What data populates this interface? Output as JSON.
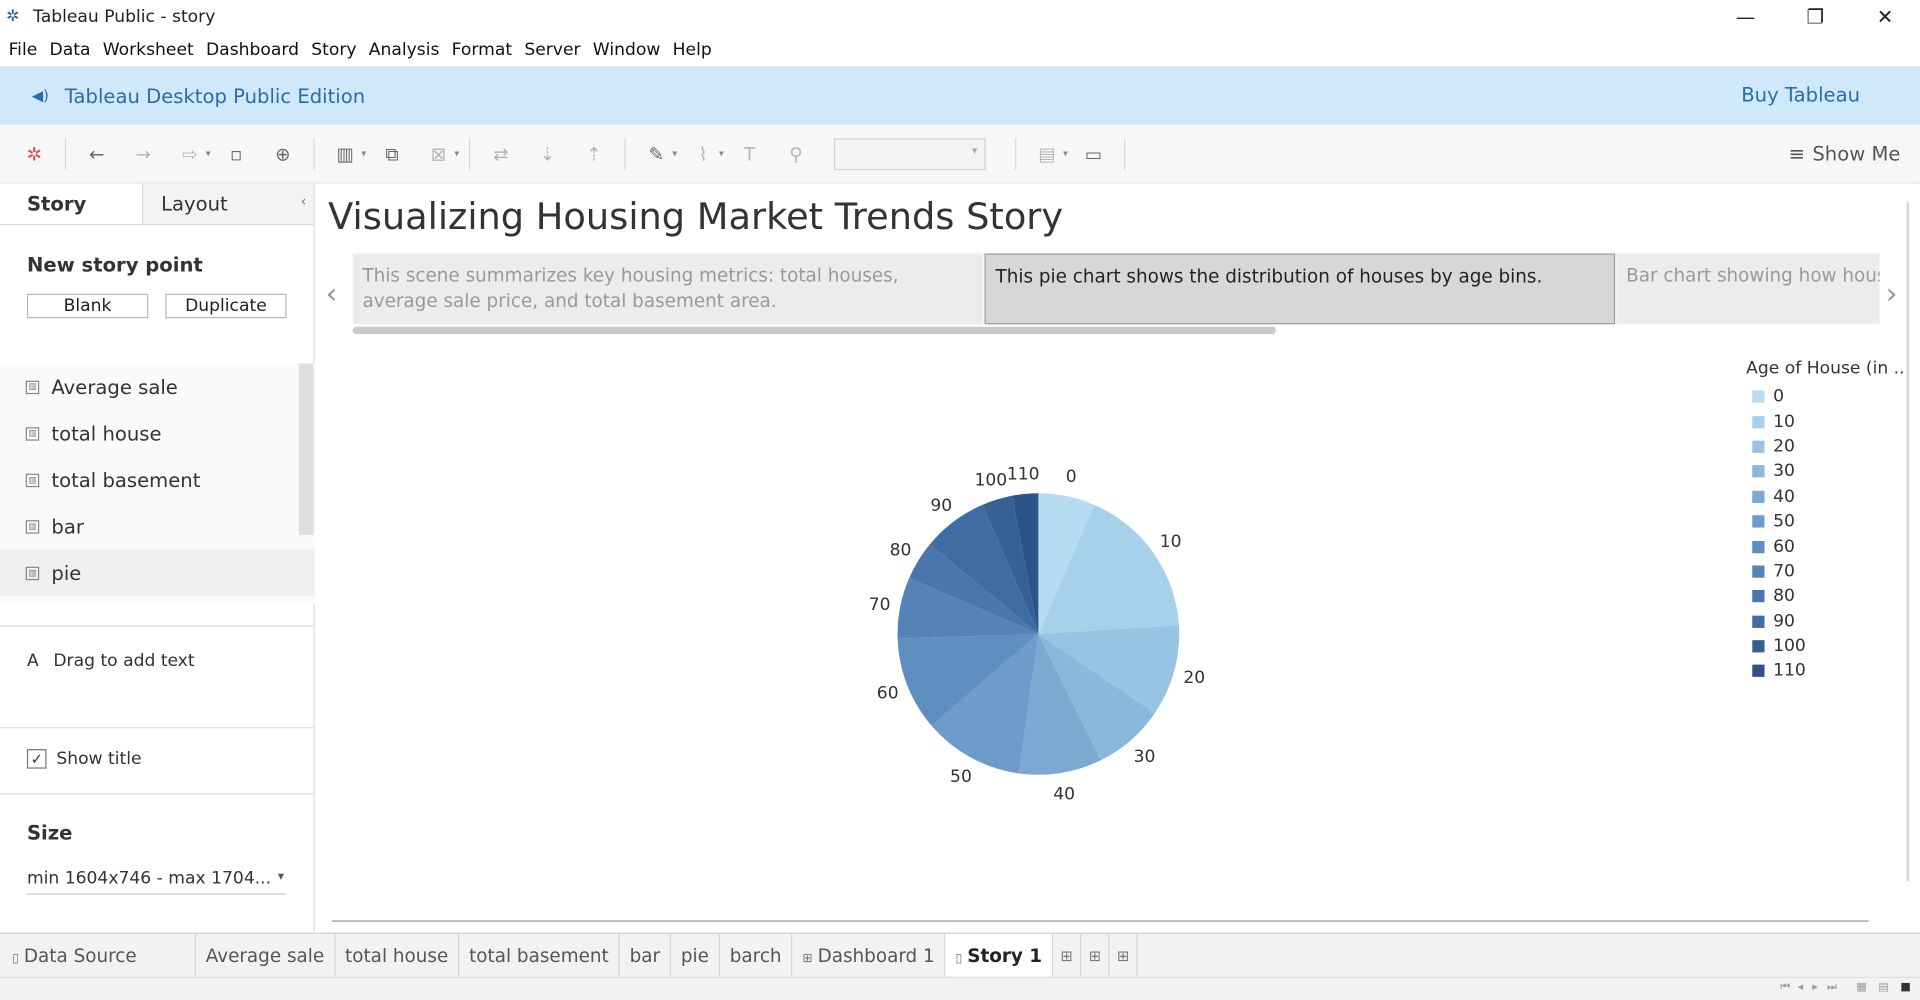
{
  "window": {
    "title": "Tableau Public - story",
    "controls": [
      "—",
      "❐",
      "✕"
    ]
  },
  "menu": [
    "File",
    "Data",
    "Worksheet",
    "Dashboard",
    "Story",
    "Analysis",
    "Format",
    "Server",
    "Window",
    "Help"
  ],
  "banner": {
    "edition": "Tableau Desktop Public Edition",
    "buy": "Buy Tableau"
  },
  "toolbar": {
    "show_me": "Show Me"
  },
  "left_panel": {
    "tabs": [
      "Story",
      "Layout"
    ],
    "new_story_point": "New story point",
    "blank": "Blank",
    "duplicate": "Duplicate",
    "sheets": [
      "Average sale",
      "total house",
      "total basement",
      "bar",
      "pie"
    ],
    "drag_text": "Drag to add text",
    "show_title": "Show title",
    "size_heading": "Size",
    "size_value": "min 1604x746 - max 1704..."
  },
  "story": {
    "title": "Visualizing Housing Market Trends Story",
    "points": [
      "This scene summarizes key housing metrics: total houses, average sale price, and total basement area.",
      "This pie chart shows the distribution of houses by age bins.",
      "Bar chart showing how house"
    ]
  },
  "chart_data": {
    "type": "pie",
    "legend_title": "Age of House (in ..",
    "categories": [
      "0",
      "10",
      "20",
      "30",
      "40",
      "50",
      "60",
      "70",
      "80",
      "90",
      "100",
      "110"
    ],
    "values": [
      6.5,
      17.5,
      10.5,
      8.2,
      9.5,
      11.5,
      10.8,
      7.0,
      4.5,
      7.5,
      3.5,
      3.0
    ],
    "colors": [
      "#b7dbf0",
      "#a7d0eb",
      "#98c4e4",
      "#8ab7dc",
      "#7aa9d2",
      "#6d9ccb",
      "#5f8fc1",
      "#5583b8",
      "#4977ad",
      "#3f6ca2",
      "#366197",
      "#2b5589"
    ],
    "legend_position": "right"
  },
  "sheet_tabs": {
    "data_source": "Data Source",
    "sheets": [
      "Average sale",
      "total house",
      "total basement",
      "bar",
      "pie",
      "barch",
      "Dashboard 1",
      "Story 1"
    ]
  }
}
